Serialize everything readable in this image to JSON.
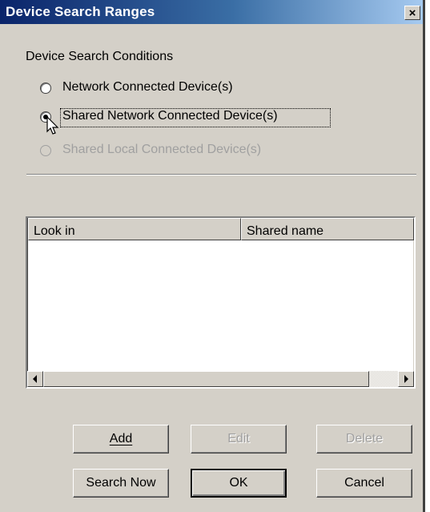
{
  "window": {
    "title": "Device Search Ranges",
    "close_glyph": "×"
  },
  "conditions": {
    "group_label": "Device Search Conditions",
    "options": [
      {
        "label": "Network Connected Device(s)",
        "checked": false,
        "enabled": true
      },
      {
        "label": "Shared Network Connected Device(s)",
        "checked": true,
        "enabled": true
      },
      {
        "label": "Shared Local Connected Device(s)",
        "checked": false,
        "enabled": false
      }
    ]
  },
  "list": {
    "columns": [
      "Look in",
      "Shared name"
    ],
    "rows": []
  },
  "buttons": {
    "add": {
      "label": "Add",
      "enabled": true
    },
    "edit": {
      "label": "Edit",
      "enabled": false
    },
    "delete": {
      "label": "Delete",
      "enabled": false
    },
    "search_now": {
      "label": "Search Now",
      "enabled": true
    },
    "ok": {
      "label": "OK",
      "enabled": true
    },
    "cancel": {
      "label": "Cancel",
      "enabled": true
    }
  },
  "icons": {
    "close": "close-icon",
    "scroll_left": "arrow-left-icon",
    "scroll_right": "arrow-right-icon",
    "cursor": "mouse-pointer-icon"
  },
  "colors": {
    "dialog_face": "#d4d0c8",
    "title_start": "#0a246a",
    "title_end": "#a6caf0",
    "disabled_text": "#a0a0a0"
  }
}
